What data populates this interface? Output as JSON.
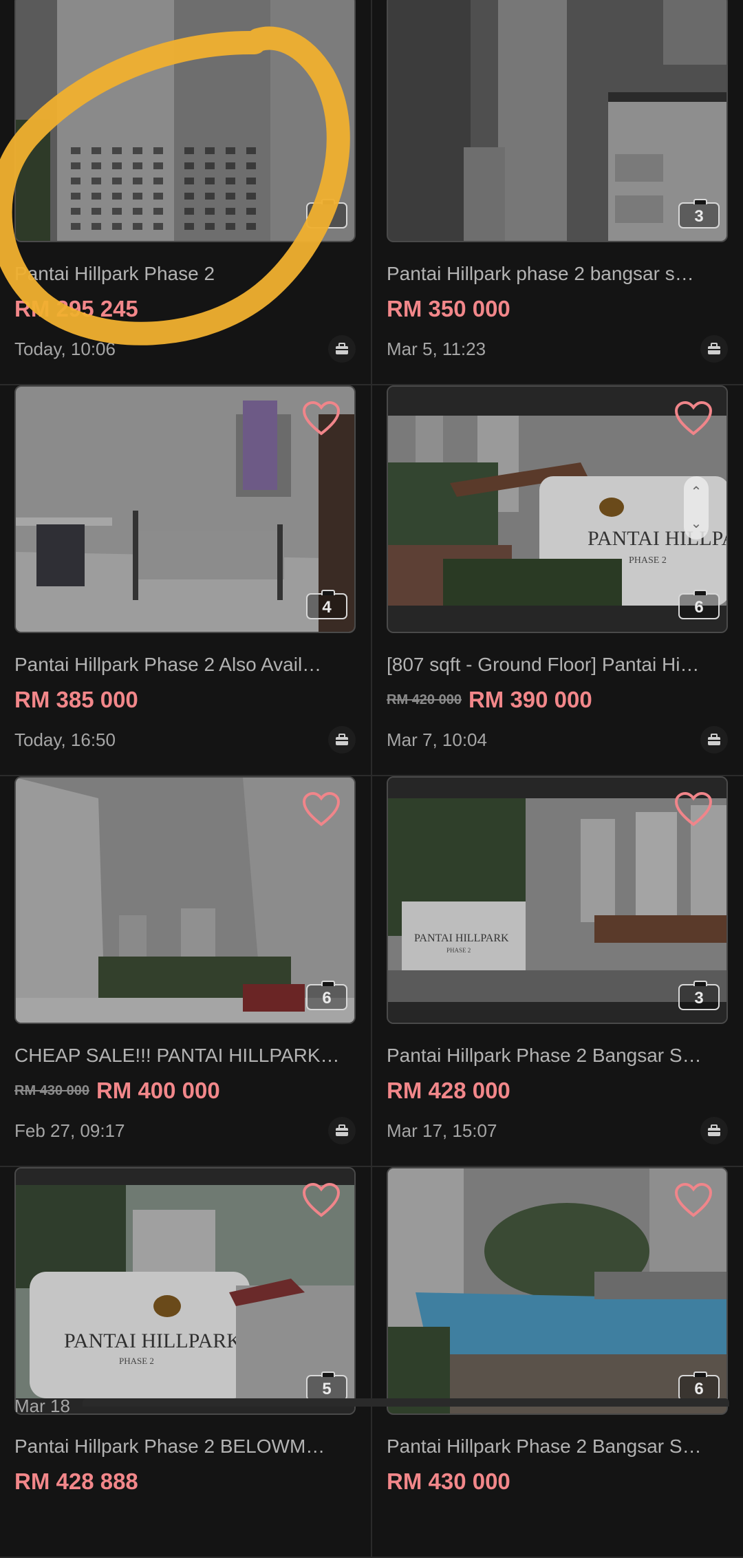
{
  "listings": [
    {
      "title": "Pantai Hillpark Phase 2",
      "price": "RM 295 245",
      "old_price": "",
      "date": "Today, 10:06",
      "photos": "",
      "scene": "tower"
    },
    {
      "title": "Pantai Hillpark phase 2 bangsar s…",
      "price": "RM 350 000",
      "old_price": "",
      "date": "Mar 5, 11:23",
      "photos": "3",
      "scene": "kitchen"
    },
    {
      "title": "Pantai Hillpark Phase 2 Also Avail…",
      "price": "RM 385 000",
      "old_price": "",
      "date": "Today, 16:50",
      "photos": "4",
      "scene": "bedroom"
    },
    {
      "title": "[807 sqft - Ground Floor] Pantai Hi…",
      "price": "RM 390 000",
      "old_price": "RM 420 000",
      "date": "Mar 7, 10:04",
      "photos": "6",
      "scene": "entrance"
    },
    {
      "title": "CHEAP SALE!!! PANTAI HILLPARK…",
      "price": "RM 400 000",
      "old_price": "RM 430 000",
      "date": "Feb 27, 09:17",
      "photos": "6",
      "scene": "towers"
    },
    {
      "title": "Pantai Hillpark Phase 2 Bangsar S…",
      "price": "RM 428 000",
      "old_price": "",
      "date": "Mar 17, 15:07",
      "photos": "3",
      "scene": "gate"
    },
    {
      "title": "Pantai Hillpark Phase 2 BELOWM…",
      "price": "RM 428 888",
      "old_price": "",
      "date": "Mar 18",
      "photos": "5",
      "scene": "signwall"
    },
    {
      "title": "Pantai Hillpark Phase 2 Bangsar S…",
      "price": "RM 430 000",
      "old_price": "",
      "date": "",
      "photos": "6",
      "scene": "pool"
    }
  ],
  "photo_signs": {
    "entrance": {
      "line1": "PANTAI HILLPARK",
      "line2": "PHASE 2"
    },
    "gate": {
      "line1": "PANTAI HILLPARK",
      "line2": "PHASE 2"
    },
    "signwall": {
      "line1": "PANTAI HILLPARK",
      "line2": "PHASE 2"
    }
  },
  "colors": {
    "price": "#f2878a",
    "background": "#141414",
    "highlight_circle": "#f0b02f"
  },
  "icons": {
    "favorite": "heart-icon",
    "photo_count": "camera-icon",
    "seller_type": "briefcase-icon",
    "scroll": "chevron-up-down-icon"
  }
}
